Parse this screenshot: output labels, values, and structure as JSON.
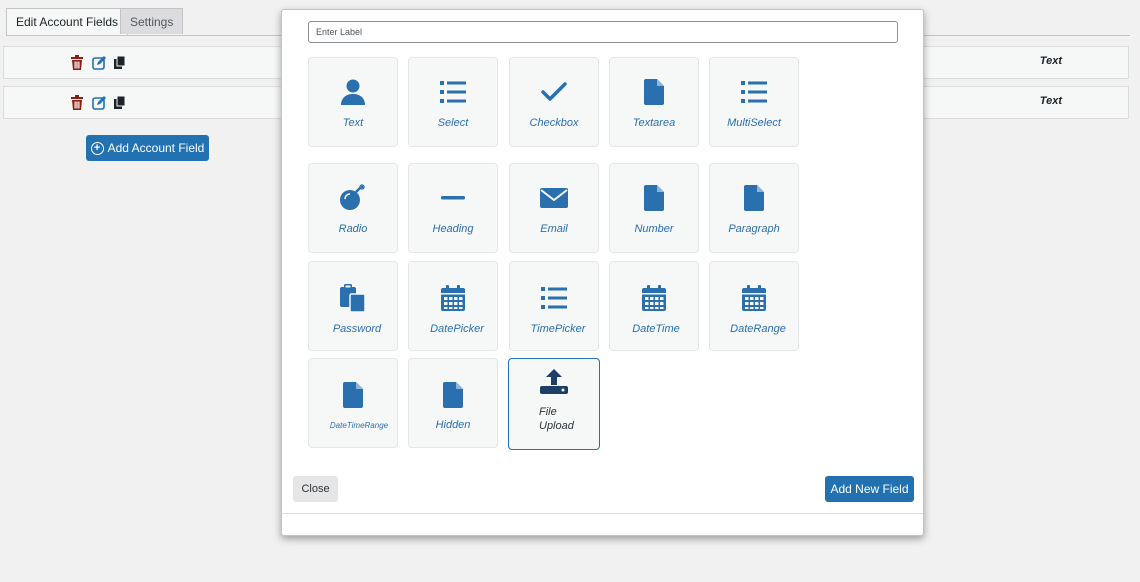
{
  "tabs": [
    {
      "label": "Edit Account Fields",
      "active": true
    },
    {
      "label": "Settings",
      "active": false
    }
  ],
  "fields": [
    {
      "type": "Text"
    },
    {
      "type": "Text"
    }
  ],
  "add_account_field_label": "Add Account Field",
  "modal": {
    "label_placeholder": "Enter Label",
    "tiles": [
      {
        "label": "Text",
        "icon": "user-icon"
      },
      {
        "label": "Select",
        "icon": "list-icon"
      },
      {
        "label": "Checkbox",
        "icon": "check-icon"
      },
      {
        "label": "Textarea",
        "icon": "file-icon"
      },
      {
        "label": "MultiSelect",
        "icon": "list-icon"
      },
      {
        "label": "Radio",
        "icon": "bomb-icon"
      },
      {
        "label": "Heading",
        "icon": "minus-icon"
      },
      {
        "label": "Email",
        "icon": "envelope-icon"
      },
      {
        "label": "Number",
        "icon": "file-icon"
      },
      {
        "label": "Paragraph",
        "icon": "file-icon"
      },
      {
        "label": "Password",
        "icon": "paste-icon"
      },
      {
        "label": "DatePicker",
        "icon": "calendar-icon"
      },
      {
        "label": "TimePicker",
        "icon": "list-icon"
      },
      {
        "label": "DateTime",
        "icon": "calendar-icon"
      },
      {
        "label": "DateRange",
        "icon": "calendar-icon"
      },
      {
        "label": "DateTimeRange",
        "icon": "file-icon"
      },
      {
        "label": "Hidden",
        "icon": "file-icon"
      },
      {
        "label": "File\nUpload",
        "icon": "upload-icon",
        "selected": true
      }
    ],
    "close_label": "Close",
    "add_new_label": "Add New Field"
  },
  "colors": {
    "accent": "#2271b1",
    "icon_blue": "#2a6fae",
    "delete_red": "#8a1f11"
  }
}
